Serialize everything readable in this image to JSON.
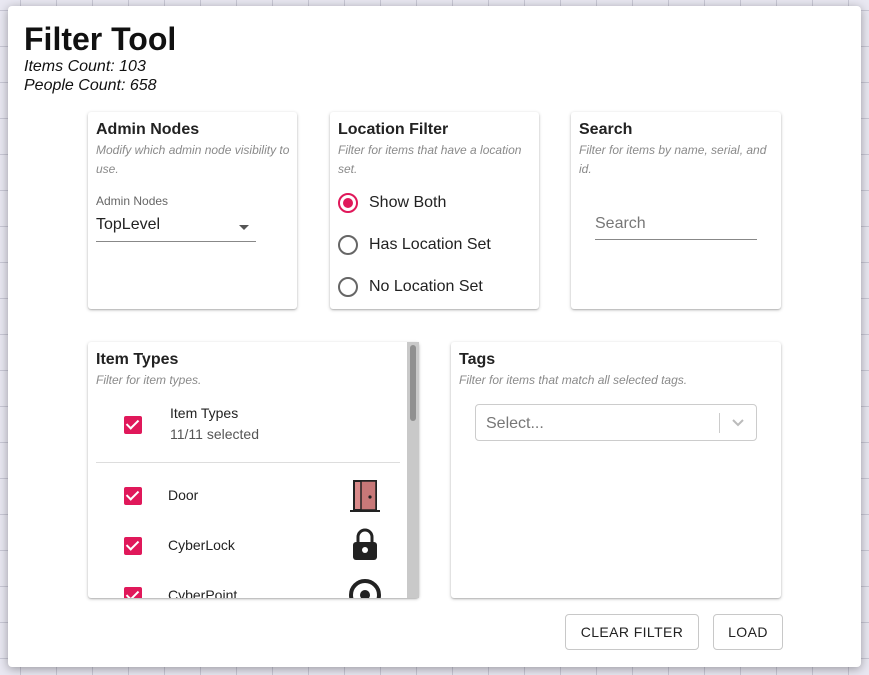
{
  "header": {
    "title": "Filter Tool",
    "items_count": "Items Count: 103",
    "people_count": "People Count: 658"
  },
  "admin": {
    "title": "Admin Nodes",
    "subtitle": "Modify which admin node visibility to use.",
    "select_label": "Admin Nodes",
    "select_value": "TopLevel",
    "icon": "chevron-down-icon"
  },
  "location": {
    "title": "Location Filter",
    "subtitle": "Filter for items that have a location set.",
    "options": [
      {
        "label": "Show Both",
        "checked": true
      },
      {
        "label": "Has Location Set",
        "checked": false
      },
      {
        "label": "No Location Set",
        "checked": false
      }
    ]
  },
  "search": {
    "title": "Search",
    "subtitle": "Filter for items by name, serial, and id.",
    "placeholder": "Search",
    "value": ""
  },
  "item_types": {
    "title": "Item Types",
    "subtitle": "Filter for item types.",
    "header_label": "Item Types",
    "header_count": "11/11 selected",
    "items": [
      {
        "label": "Door",
        "checked": true,
        "icon": "door-icon"
      },
      {
        "label": "CyberLock",
        "checked": true,
        "icon": "padlock-icon"
      },
      {
        "label": "CyberPoint",
        "checked": true,
        "icon": "point-icon"
      }
    ]
  },
  "tags": {
    "title": "Tags",
    "subtitle": "Filter for items that match all selected tags.",
    "placeholder": "Select..."
  },
  "buttons": {
    "clear": "CLEAR FILTER",
    "load": "LOAD"
  },
  "colors": {
    "accent": "#e0185a",
    "door": "#d98a8a"
  }
}
